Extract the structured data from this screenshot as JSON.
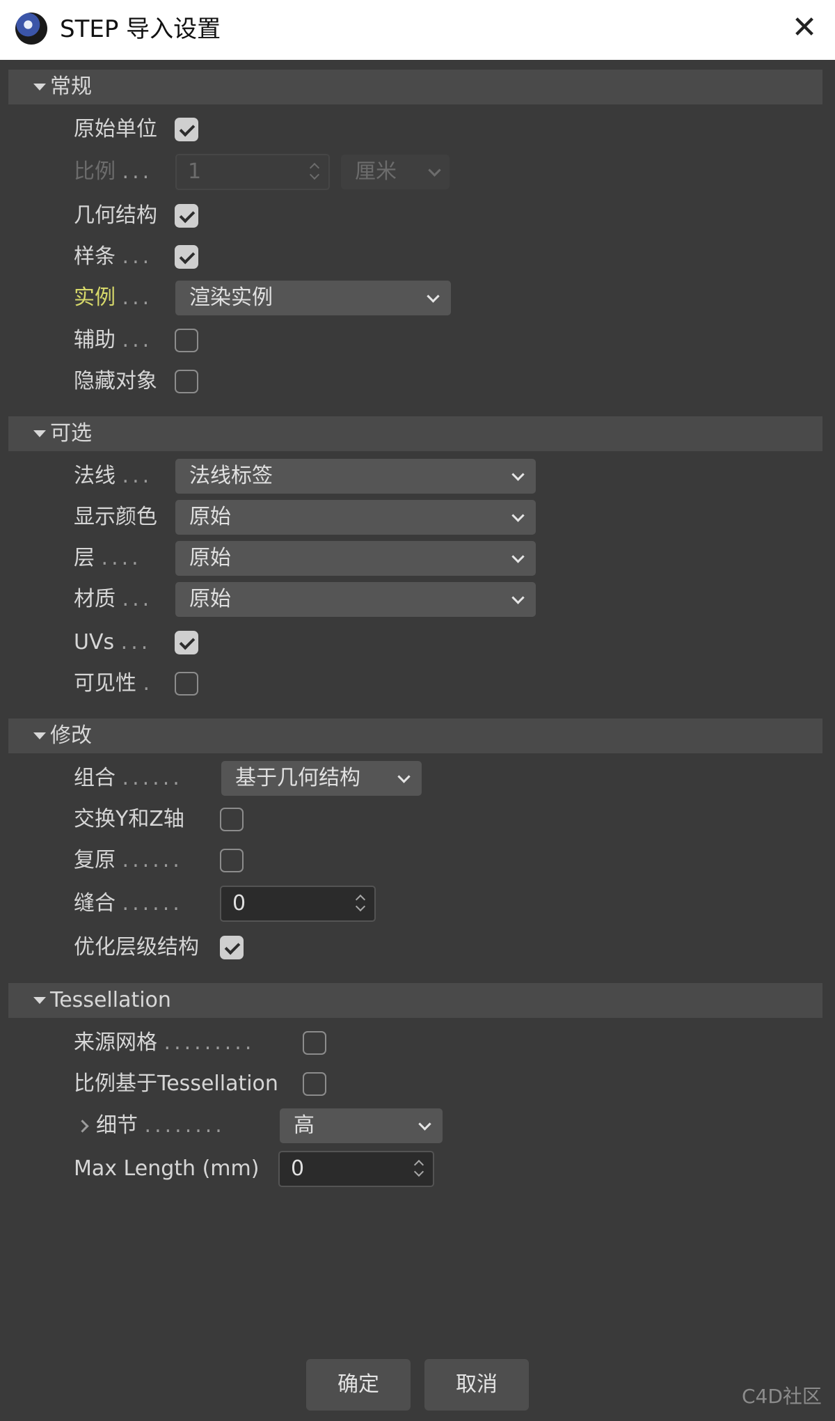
{
  "window": {
    "title": "STEP 导入设置",
    "close_icon": "close-icon"
  },
  "sections": {
    "general": {
      "title": "常规",
      "rows": {
        "original_units": {
          "label": "原始单位",
          "checked": true
        },
        "scale": {
          "label": "比例",
          "dots": "...",
          "value": "1",
          "unit": "厘米",
          "disabled": true
        },
        "geometry": {
          "label": "几何结构",
          "checked": true
        },
        "splines": {
          "label": "样条",
          "dots": "...",
          "checked": true
        },
        "instances": {
          "label": "实例",
          "dots": "...",
          "value": "渲染实例"
        },
        "helpers": {
          "label": "辅助",
          "dots": "...",
          "checked": false
        },
        "hidden_objects": {
          "label": "隐藏对象",
          "checked": false
        }
      }
    },
    "optional": {
      "title": "可选",
      "rows": {
        "normals": {
          "label": "法线",
          "dots": "...",
          "value": "法线标签"
        },
        "display_color": {
          "label": "显示颜色",
          "value": "原始"
        },
        "layers": {
          "label": "层",
          "dots": "....",
          "value": "原始"
        },
        "materials": {
          "label": "材质",
          "dots": "...",
          "value": "原始"
        },
        "uvs": {
          "label": "UVs",
          "dots": "...",
          "checked": true
        },
        "visibility": {
          "label": "可见性",
          "dots": ".",
          "checked": false
        }
      }
    },
    "modify": {
      "title": "修改",
      "rows": {
        "grouping": {
          "label": "组合",
          "dots": "......",
          "value": "基于几何结构"
        },
        "swap_yz": {
          "label": "交换Y和Z轴",
          "checked": false
        },
        "restore": {
          "label": "复原",
          "dots": "......",
          "checked": false
        },
        "stitch": {
          "label": "缝合",
          "dots": "......",
          "value": "0"
        },
        "optimize_hierarchy": {
          "label": "优化层级结构",
          "checked": true
        }
      }
    },
    "tessellation": {
      "title": "Tessellation",
      "rows": {
        "source_mesh": {
          "label": "来源网格",
          "dots": ".........",
          "checked": false
        },
        "scale_by_tessellation": {
          "label": "比例基于Tessellation",
          "checked": false
        },
        "detail": {
          "label": "细节",
          "dots": "........",
          "value": "高"
        },
        "max_length": {
          "label": "Max Length (mm)",
          "value": "0"
        }
      }
    }
  },
  "buttons": {
    "ok": "确定",
    "cancel": "取消"
  },
  "watermark": "C4D社区",
  "colors": {
    "background": "#3a3a3a",
    "section_header": "#4a4a4a",
    "accent_label": "#d6d86a"
  }
}
